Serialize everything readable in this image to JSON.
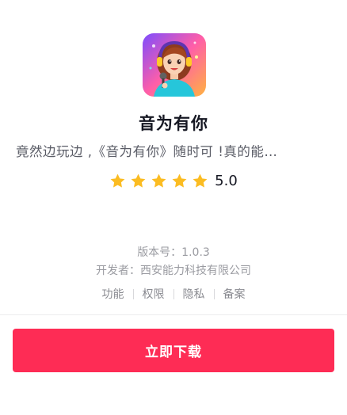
{
  "app": {
    "name": "音为有你",
    "description": "竟然边玩边     ,《音为有你》随时可      !真的能…",
    "rating": "5.0",
    "stars": 5,
    "version": "版本号：1.0.3",
    "developer": "开发者：西安能力科技有限公司",
    "icon": "singer-girl-with-headphones-and-microphone"
  },
  "links": [
    "功能",
    "权限",
    "隐私",
    "备案"
  ],
  "download_label": "立即下载",
  "colors": {
    "accent": "#fe2c55",
    "star": "#fbbc22"
  }
}
